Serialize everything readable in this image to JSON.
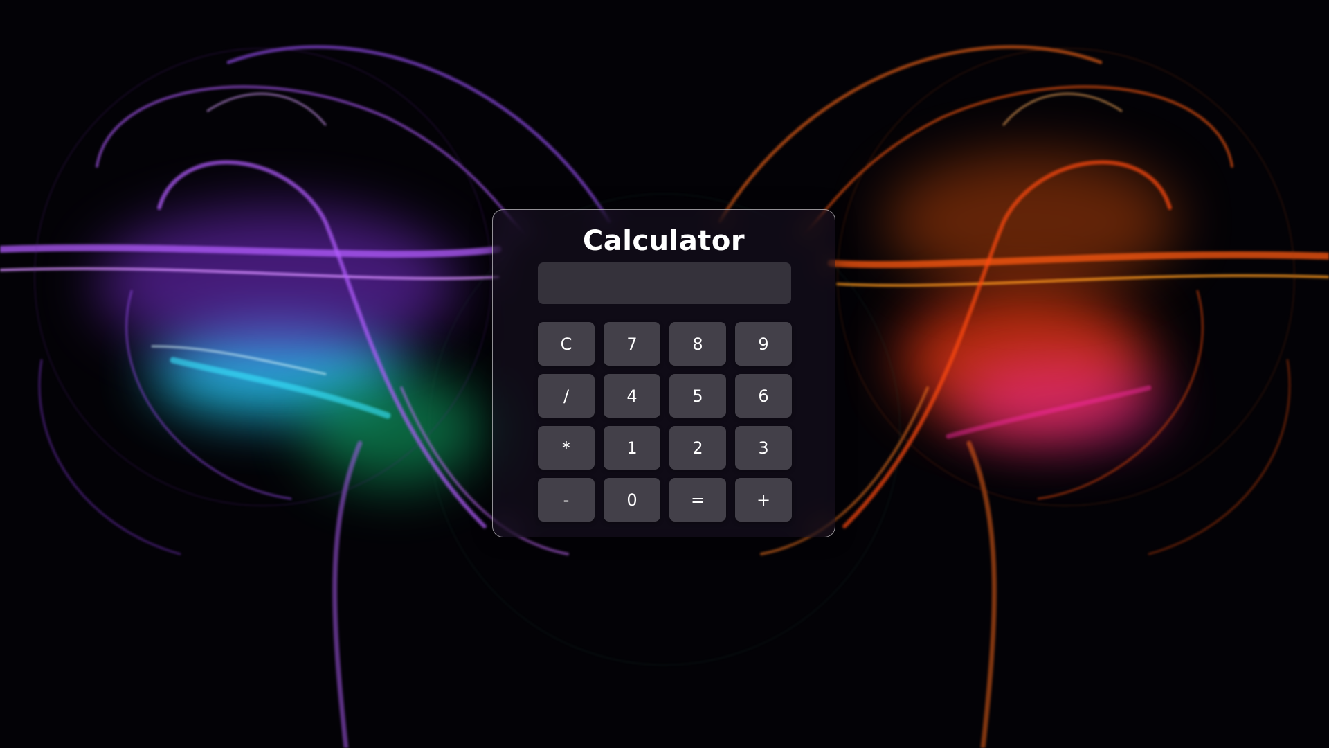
{
  "calculator": {
    "title": "Calculator",
    "display_value": "",
    "keys": [
      {
        "label": "C",
        "name": "clear-button"
      },
      {
        "label": "7",
        "name": "digit-7-button"
      },
      {
        "label": "8",
        "name": "digit-8-button"
      },
      {
        "label": "9",
        "name": "digit-9-button"
      },
      {
        "label": "/",
        "name": "divide-button"
      },
      {
        "label": "4",
        "name": "digit-4-button"
      },
      {
        "label": "5",
        "name": "digit-5-button"
      },
      {
        "label": "6",
        "name": "digit-6-button"
      },
      {
        "label": "*",
        "name": "multiply-button"
      },
      {
        "label": "1",
        "name": "digit-1-button"
      },
      {
        "label": "2",
        "name": "digit-2-button"
      },
      {
        "label": "3",
        "name": "digit-3-button"
      },
      {
        "label": "-",
        "name": "subtract-button"
      },
      {
        "label": "0",
        "name": "digit-0-button"
      },
      {
        "label": "=",
        "name": "equals-button"
      },
      {
        "label": "+",
        "name": "add-button"
      }
    ]
  },
  "colors": {
    "background": "#000000",
    "left_accent_purple": "#b35cff",
    "left_accent_cyan": "#2ee8ff",
    "left_accent_green": "#17c27a",
    "right_accent_orange": "#ff5a12",
    "right_accent_amber": "#ff9a1e",
    "right_accent_magenta": "#ff2aa8",
    "panel_border": "#ffffff"
  }
}
